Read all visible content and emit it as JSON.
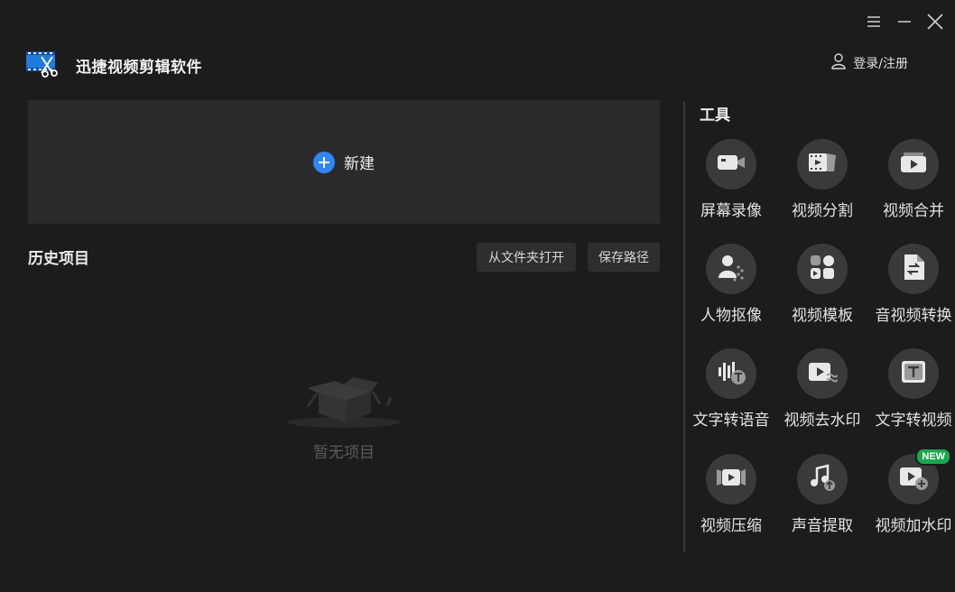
{
  "app": {
    "title": "迅捷视频剪辑软件"
  },
  "header": {
    "login_label": "登录/注册"
  },
  "main": {
    "new_label": "新建",
    "history_title": "历史项目",
    "open_folder_label": "从文件夹打开",
    "save_path_label": "保存路径",
    "empty_text": "暂无项目"
  },
  "tools": {
    "title": "工具",
    "items": [
      {
        "label": "屏幕录像",
        "icon": "camera-icon"
      },
      {
        "label": "视频分割",
        "icon": "film-split-icon"
      },
      {
        "label": "视频合并",
        "icon": "play-merge-icon"
      },
      {
        "label": "人物抠像",
        "icon": "person-cutout-icon"
      },
      {
        "label": "视频模板",
        "icon": "template-icon"
      },
      {
        "label": "音视频转换",
        "icon": "file-convert-icon"
      },
      {
        "label": "文字转语音",
        "icon": "text-to-speech-icon"
      },
      {
        "label": "视频去水印",
        "icon": "remove-watermark-icon"
      },
      {
        "label": "文字转视频",
        "icon": "text-to-video-icon"
      },
      {
        "label": "视频压缩",
        "icon": "compress-icon"
      },
      {
        "label": "声音提取",
        "icon": "audio-extract-icon"
      },
      {
        "label": "视频加水印",
        "icon": "add-watermark-icon",
        "badge": "NEW"
      }
    ]
  },
  "colors": {
    "accent": "#2f86f6",
    "badge": "#19a84b",
    "background": "#1c1c1c"
  }
}
